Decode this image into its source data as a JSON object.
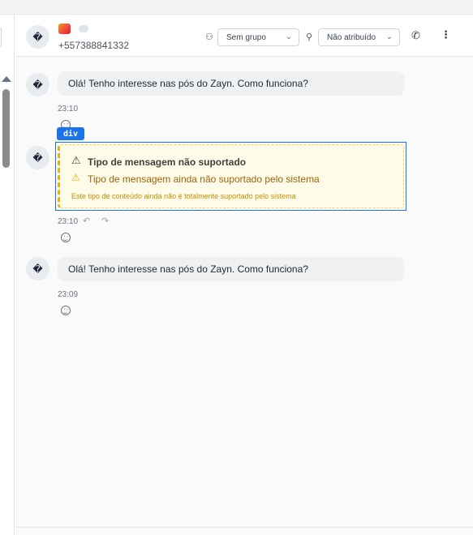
{
  "header": {
    "avatar_glyph": "�",
    "phone": "+557388841332",
    "group_select": "Sem grupo",
    "assign_select": "Não atribuído",
    "icons": [
      "users-icon",
      "user-icon",
      "phone-icon",
      "more-vertical-icon",
      "chevron-down-icon"
    ]
  },
  "messages": [
    {
      "avatar_glyph": "�",
      "text": "Olá! Tenho interesse nas pós do Zayn. Como funciona?",
      "time": "23:10"
    },
    {
      "avatar_glyph": "�",
      "unsupported": {
        "title": "Tipo de mensagem não suportado",
        "subtitle": "Tipo de mensagem ainda não suportado pelo sistema",
        "note": "Este tipo de conteúdo ainda não é totalmente suportado pelo sistema"
      },
      "time": "23:10"
    },
    {
      "avatar_glyph": "�",
      "text": "Olá! Tenho interesse nas pós do Zayn. Como funciona?",
      "time": "23:09"
    }
  ],
  "inspector_tag": "div",
  "colors": {
    "accent": "#1a73e8",
    "warning_bg": "#fefce8",
    "warning_border": "#eab308",
    "bubble_bg": "#f0f1f3"
  }
}
